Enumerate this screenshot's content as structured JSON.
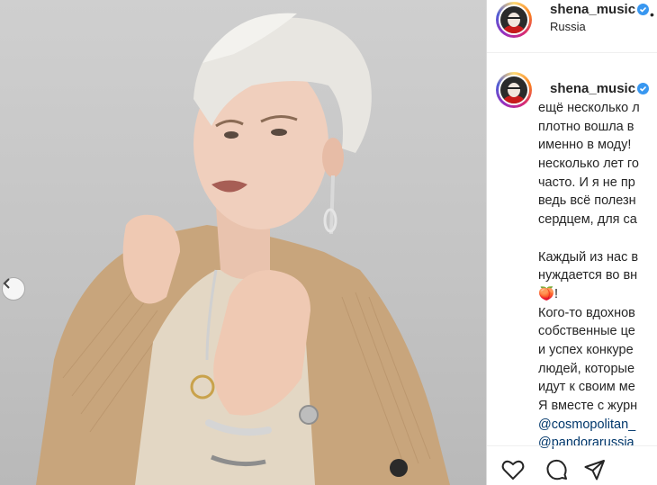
{
  "header": {
    "username": "shena_music",
    "location": "Russia"
  },
  "caption": {
    "username": "shena_music",
    "lines": [
      "ещё несколько л",
      "плотно вошла в",
      "именно в моду!",
      "несколько лет го",
      "часто. И я не пр",
      "ведь всё полезн",
      "сердцем, для са",
      "",
      "Каждый из нас в",
      "нуждается во вн",
      "🍑!",
      "Кого-то вдохнов",
      "собственные це",
      "и успех конкуре",
      "людей, которые",
      "идут к своим ме",
      "Я вместе с журн",
      "@cosmopolitan_",
      "@pandorarussia"
    ]
  },
  "icons": {
    "carousel_prev": "chevron-left-icon",
    "like": "heart-icon",
    "comment": "comment-icon",
    "share": "share-icon",
    "verified": "verified-badge-icon"
  },
  "colors": {
    "verified": "#3897f0",
    "mention": "#00376b",
    "text": "#262626"
  }
}
